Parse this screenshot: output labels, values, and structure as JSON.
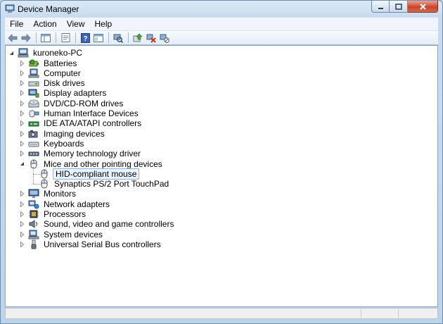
{
  "window": {
    "title": "Device Manager"
  },
  "menu": [
    "File",
    "Action",
    "View",
    "Help"
  ],
  "toolbar": [
    "back-arrow-icon",
    "forward-arrow-icon",
    "properties-icon",
    "console-icon",
    "help-icon",
    "view-icon",
    "scan-hardware-icon",
    "update-driver-icon",
    "uninstall-icon",
    "disable-icon"
  ],
  "tree": {
    "root": "kuroneko-PC",
    "items": [
      {
        "label": "Batteries",
        "icon": "battery-icon"
      },
      {
        "label": "Computer",
        "icon": "computer-icon"
      },
      {
        "label": "Disk drives",
        "icon": "disk-drive-icon"
      },
      {
        "label": "Display adapters",
        "icon": "display-adapter-icon"
      },
      {
        "label": "DVD/CD-ROM drives",
        "icon": "dvd-drive-icon"
      },
      {
        "label": "Human Interface Devices",
        "icon": "hid-icon"
      },
      {
        "label": "IDE ATA/ATAPI controllers",
        "icon": "ide-controller-icon"
      },
      {
        "label": "Imaging devices",
        "icon": "camera-icon"
      },
      {
        "label": "Keyboards",
        "icon": "keyboard-icon"
      },
      {
        "label": "Memory technology driver",
        "icon": "memory-icon"
      },
      {
        "label": "Mice and other pointing devices",
        "icon": "mouse-icon",
        "expanded": true,
        "children": [
          {
            "label": "HID-compliant mouse",
            "icon": "mouse-icon",
            "selected": true
          },
          {
            "label": "Synaptics PS/2 Port TouchPad",
            "icon": "mouse-icon"
          }
        ]
      },
      {
        "label": "Monitors",
        "icon": "monitor-icon"
      },
      {
        "label": "Network adapters",
        "icon": "network-adapter-icon"
      },
      {
        "label": "Processors",
        "icon": "processor-icon"
      },
      {
        "label": "Sound, video and game controllers",
        "icon": "sound-icon"
      },
      {
        "label": "System devices",
        "icon": "system-device-icon"
      },
      {
        "label": "Universal Serial Bus controllers",
        "icon": "usb-icon"
      }
    ]
  }
}
